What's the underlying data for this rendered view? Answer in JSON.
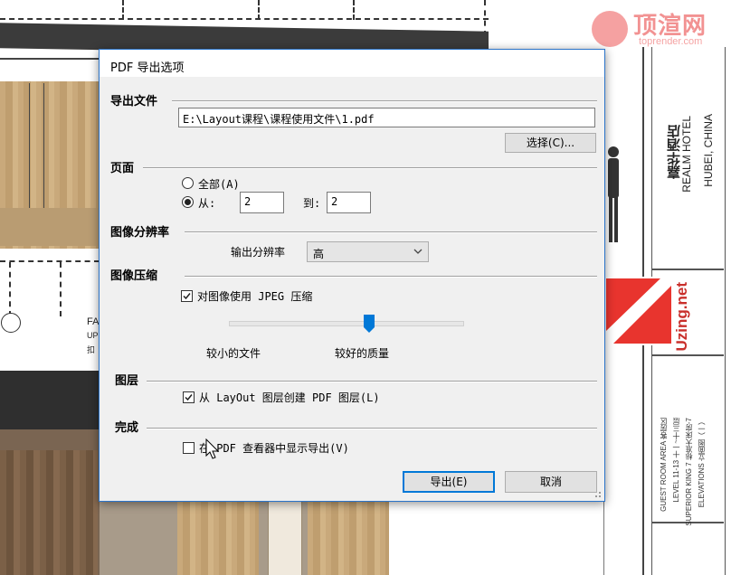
{
  "watermark": {
    "brand": "顶渲网",
    "url": "toprender.com"
  },
  "background": {
    "hotel_name_cn": "嘉华酒店",
    "hotel_name_en": "REALM HOTEL",
    "location": "HUBEI, CHINA",
    "logo_text": "Uzing.net",
    "room_lines": [
      "GUEST ROOM AREA 客房区",
      "LEVEL 11-13 十一~十三层",
      "SUPERIOR KING 7 标准大床房-7",
      "ELEVATIONS 立面图（一）"
    ],
    "fa_label": "FA",
    "fa_sub": "UP",
    "fa_sub2": "扣"
  },
  "dialog": {
    "title": "PDF 导出选项",
    "sections": {
      "export_file": "导出文件",
      "pages": "页面",
      "resolution": "图像分辨率",
      "compression": "图像压缩",
      "layers": "图层",
      "finish": "完成"
    },
    "file_path": "E:\\Layout课程\\课程使用文件\\1.pdf",
    "choose_button": "选择(C)...",
    "pages": {
      "all_label": "全部(A)",
      "from_label": "从:",
      "from_value": "2",
      "to_label": "到:",
      "to_value": "2",
      "selected": "from"
    },
    "resolution": {
      "label": "输出分辨率",
      "value": "高"
    },
    "compression": {
      "use_jpeg_label": "对图像使用 JPEG 压缩",
      "use_jpeg_checked": true,
      "smaller_file": "较小的文件",
      "better_quality": "较好的质量",
      "quality_level": 0.6
    },
    "layers": {
      "create_layers_label": "从 LayOut 图层创建 PDF 图层(L)",
      "checked": true
    },
    "finish": {
      "show_in_viewer_label": "在 PDF 查看器中显示导出(V)",
      "checked": false
    },
    "export_button": "导出(E)",
    "cancel_button": "取消"
  }
}
